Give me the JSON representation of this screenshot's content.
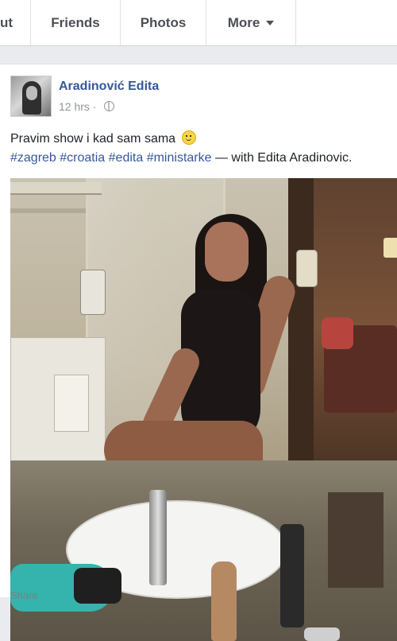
{
  "nav": {
    "tabs": [
      {
        "label": "ut"
      },
      {
        "label": "Friends"
      },
      {
        "label": "Photos"
      },
      {
        "label": "More"
      }
    ]
  },
  "post": {
    "author": "Aradinović Edita",
    "time": "12 hrs · ",
    "text": "Pravim show i kad sam sama",
    "hashtags": [
      "#zagreb",
      "#croatia",
      "#edita",
      "#ministarke"
    ],
    "with_text": " — with Edita Aradinovic."
  },
  "actions": {
    "share_label": "Share"
  },
  "colors": {
    "link": "#365899",
    "background": "#e9ebee",
    "card": "#ffffff"
  }
}
